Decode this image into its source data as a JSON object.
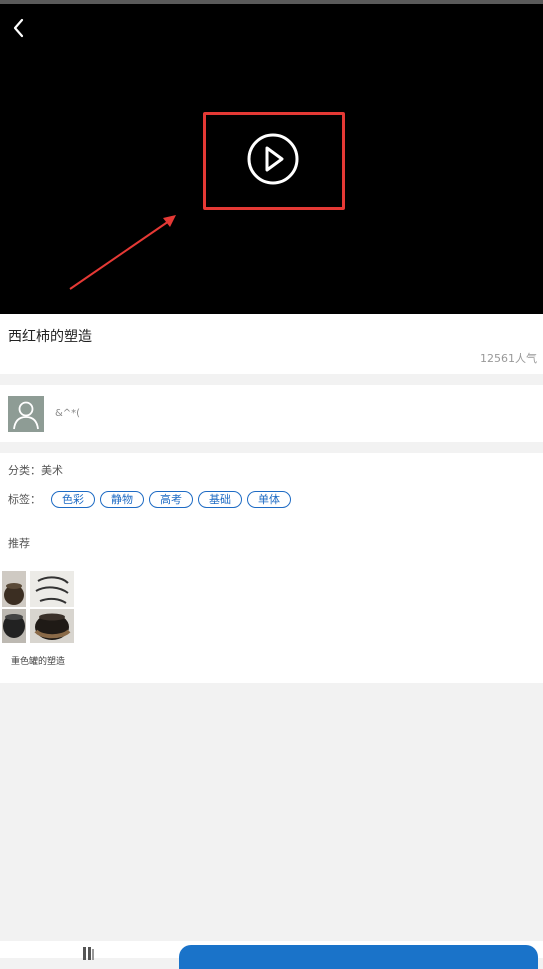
{
  "video": {
    "back_icon": "chevron-left-icon",
    "play_icon": "play-circle-icon"
  },
  "title_card": {
    "title": "西红柿的塑造",
    "views": "12561人气"
  },
  "author": {
    "avatar_icon": "user-avatar-icon",
    "name": "&^*("
  },
  "info": {
    "category": "分类：美术",
    "tags_label": "标签：",
    "tags": [
      "色彩",
      "静物",
      "高考",
      "基础",
      "单体"
    ],
    "recommend_label": "推荐",
    "recommendations": [
      {
        "caption": "重色罐的塑造"
      }
    ]
  },
  "bottom_bar": {
    "icon": "book-icon"
  },
  "colors": {
    "accent": "#1a73c9",
    "highlight": "#e53935",
    "tag": "#1e6bc4"
  }
}
